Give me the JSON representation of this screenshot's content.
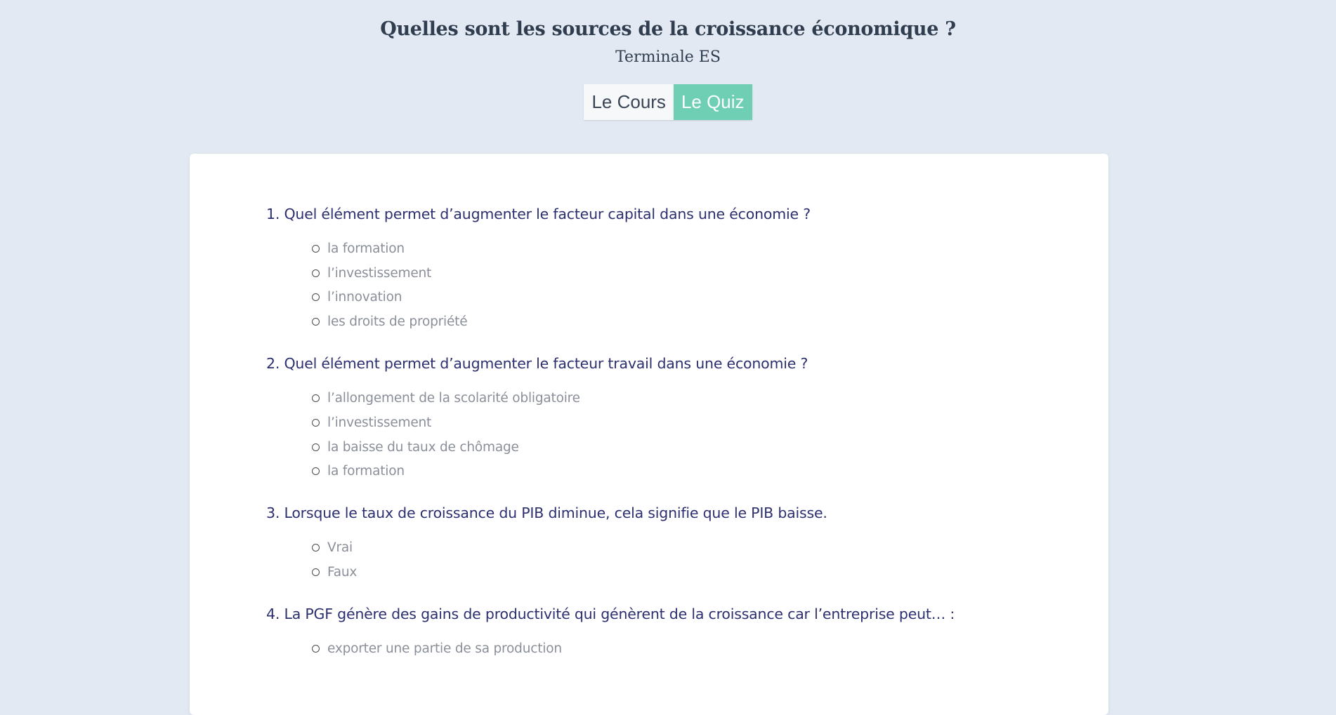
{
  "header": {
    "title": "Quelles sont les sources de la croissance économique ?",
    "subtitle": "Terminale ES"
  },
  "tabs": [
    {
      "label": "Le Cours",
      "active": false
    },
    {
      "label": "Le Quiz",
      "active": true
    }
  ],
  "colors": {
    "background": "#e3e9f2",
    "accent": "#6fcfb5",
    "question_text": "#2c2f6f",
    "option_text": "#8a8f99"
  },
  "quiz": {
    "questions": [
      {
        "text": "1. Quel élément permet d’augmenter le facteur capital dans une économie ?",
        "options": [
          "la formation",
          "l’investissement",
          "l’innovation",
          "les droits de propriété"
        ]
      },
      {
        "text": "2. Quel élément permet d’augmenter le facteur travail dans une économie ?",
        "options": [
          "l’allongement de la scolarité obligatoire",
          "l’investissement",
          "la baisse du taux de chômage",
          "la formation"
        ]
      },
      {
        "text": "3. Lorsque le taux de croissance du PIB diminue, cela signifie que le PIB baisse.",
        "options": [
          "Vrai",
          "Faux"
        ]
      },
      {
        "text": "4. La PGF génère des gains de productivité qui génèrent de la croissance car l’entreprise peut… :",
        "options": [
          "exporter une partie de sa production"
        ]
      }
    ]
  }
}
